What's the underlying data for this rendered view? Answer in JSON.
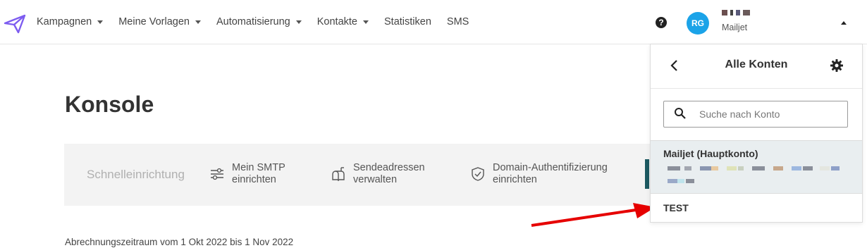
{
  "nav": {
    "items": [
      {
        "label": "Kampagnen",
        "dropdown": true
      },
      {
        "label": "Meine Vorlagen",
        "dropdown": true
      },
      {
        "label": "Automatisierung",
        "dropdown": true
      },
      {
        "label": "Kontakte",
        "dropdown": true
      },
      {
        "label": "Statistiken",
        "dropdown": false
      },
      {
        "label": "SMS",
        "dropdown": false
      }
    ],
    "help_icon": "question-circle-icon"
  },
  "account": {
    "initials": "RG",
    "subtitle": "Mailjet"
  },
  "page": {
    "title": "Konsole"
  },
  "quick_setup": {
    "label": "Schnelleinrichtung",
    "items": [
      {
        "icon": "sliders-icon",
        "line1": "Mein SMTP",
        "line2": "einrichten"
      },
      {
        "icon": "mailbox-icon",
        "line1": "Sendeadressen",
        "line2": "verwalten"
      },
      {
        "icon": "shield-check-icon",
        "line1": "Domain-Authentifizierung",
        "line2": "einrichten"
      }
    ]
  },
  "billing": {
    "text": "Abrechnungszeitraum vom 1 Okt 2022 bis 1 Nov 2022"
  },
  "dropdown": {
    "title": "Alle Konten",
    "search_placeholder": "Suche nach Konto",
    "main_account": "Mailjet (Hauptkonto)",
    "sub_account": "TEST"
  },
  "colors": {
    "brand": "#7d5cf0",
    "avatar": "#1ba3e8",
    "accent_bar": "#1c5961",
    "arrow": "#e60000",
    "selected_row": "#e9eef0"
  }
}
